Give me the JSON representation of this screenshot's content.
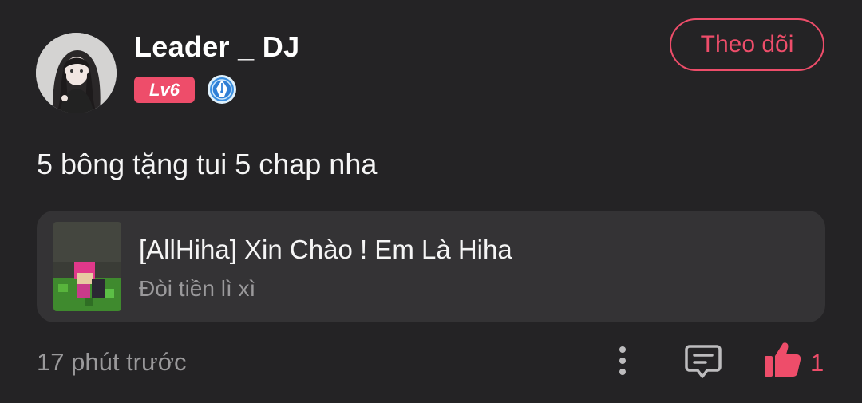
{
  "user": {
    "name": "Leader _ DJ",
    "level": "Lv6",
    "badge_icon": "pen-nib-badge-icon"
  },
  "follow_button": {
    "label": "Theo dõi"
  },
  "comment": {
    "text": "5 bông tặng tui 5 chap nha"
  },
  "linked_story": {
    "title": "[AllHiha] Xin Chào ! Em Là Hiha",
    "subtitle": "Đòi tiền lì xì"
  },
  "footer": {
    "timestamp": "17 phút trước",
    "like_count": "1"
  },
  "colors": {
    "background": "#242325",
    "card": "#343335",
    "accent": "#ee4d6a",
    "muted_text": "#9a999b"
  }
}
